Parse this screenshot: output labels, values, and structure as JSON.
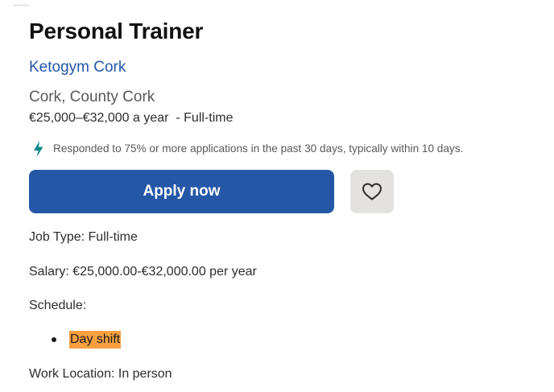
{
  "job": {
    "title": "Personal Trainer",
    "company": "Ketogym Cork",
    "location": "Cork, County Cork",
    "salary_line": "€25,000–€32,000 a year  - Full-time"
  },
  "responsiveness": {
    "icon": "lightning-bolt-icon",
    "text": "Responded to 75% or more applications in the past 30 days, typically within 10 days."
  },
  "actions": {
    "apply_label": "Apply now",
    "save_icon": "heart-icon"
  },
  "details": {
    "job_type": "Job Type: Full-time",
    "salary": "Salary: €25,000.00-€32,000.00 per year",
    "schedule_label": "Schedule:",
    "schedule_items": [
      "Day shift"
    ],
    "work_location": "Work Location: In person"
  },
  "colors": {
    "brand_blue": "#2557a7",
    "lightning": "#0d8a8c",
    "highlight": "#f8a040",
    "save_button_bg": "#e4e2e0"
  }
}
